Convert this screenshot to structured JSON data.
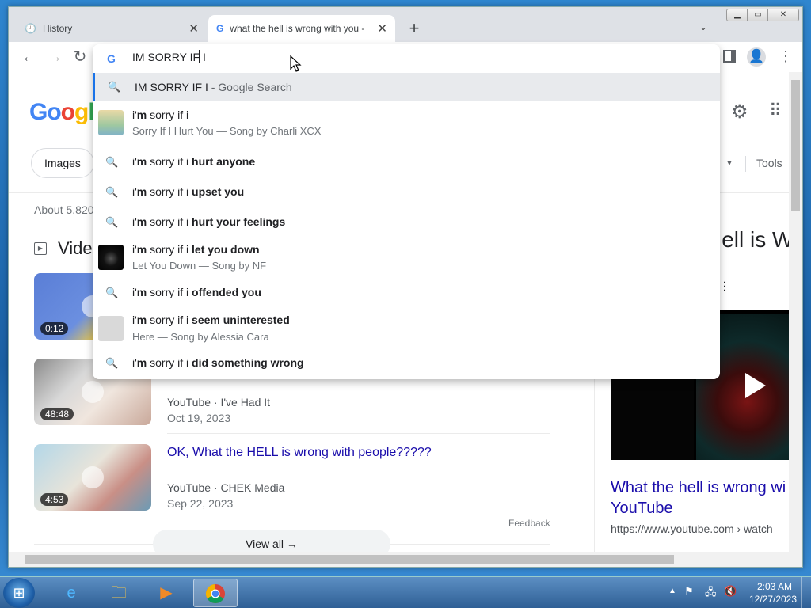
{
  "browser": {
    "tabs": [
      {
        "title": "History",
        "close": "✕",
        "icon": "history-icon"
      },
      {
        "title": "what the hell is wrong with you -",
        "close": "✕",
        "icon": "google-icon"
      }
    ],
    "new_tab": "+",
    "tab_search": "⌄",
    "window_buttons": {
      "minimize": "▁",
      "maximize": "▭",
      "close": "✕"
    },
    "nav": {
      "back": "←",
      "forward": "→",
      "reload": "↻"
    },
    "profile_icon": "👤",
    "menu_icon": "⋮"
  },
  "omnibox": {
    "text": "IM SORRY IF I",
    "g_icon": "G",
    "search_suggestion": {
      "query": "IM SORRY IF I",
      "hint": " - Google Search"
    },
    "suggestions": [
      {
        "pre": "i'",
        "bold1": "m",
        "mid": " sorry if i",
        "bold2": "",
        "sub": "Sorry If I Hurt You — Song by Charli XCX",
        "thumb": true
      },
      {
        "pre": "i'",
        "bold1": "m",
        "mid": " sorry if i ",
        "bold2": "hurt anyone"
      },
      {
        "pre": "i'",
        "bold1": "m",
        "mid": " sorry if i ",
        "bold2": "upset you"
      },
      {
        "pre": "i'",
        "bold1": "m",
        "mid": " sorry if i ",
        "bold2": "hurt your feelings"
      },
      {
        "pre": "i'",
        "bold1": "m",
        "mid": " sorry if i ",
        "bold2": "let you down",
        "sub": "Let You Down — Song by NF",
        "thumb": true
      },
      {
        "pre": "i'",
        "bold1": "m",
        "mid": " sorry if i ",
        "bold2": "offended you"
      },
      {
        "pre": "i'",
        "bold1": "m",
        "mid": " sorry if i ",
        "bold2": "seem uninterested",
        "sub": "Here — Song by Alessia Cara",
        "thumb": true
      },
      {
        "pre": "i'",
        "bold1": "m",
        "mid": " sorry if i ",
        "bold2": "did something wrong"
      }
    ]
  },
  "page": {
    "logo": [
      "Go",
      "o",
      "g",
      "l"
    ],
    "filter_images": "Images",
    "tools": "Tools",
    "stats": "About 5,820",
    "videos_heading": "Vide",
    "videos": [
      {
        "duration": "0:12"
      },
      {
        "duration": "48:48",
        "source": "YouTube",
        "channel": " · I've Had It",
        "date": "Oct 19, 2023"
      },
      {
        "duration": "4:53",
        "title": "OK, What the HELL is wrong with people?????",
        "source": "YouTube",
        "channel": " · CHEK Media",
        "date": "Sep 22, 2023"
      }
    ],
    "feedback": "Feedback",
    "view_all": "View all  →",
    "knowledge": {
      "title_fragment": "Hell is W",
      "link": "What the hell is wrong wi YouTube",
      "url": "https://www.youtube.com › watch"
    }
  },
  "taskbar": {
    "start": "⊞",
    "apps": [
      "e",
      "🗀",
      "▶"
    ],
    "time": "2:03 AM",
    "date": "12/27/2023",
    "tray_up": "▲"
  }
}
